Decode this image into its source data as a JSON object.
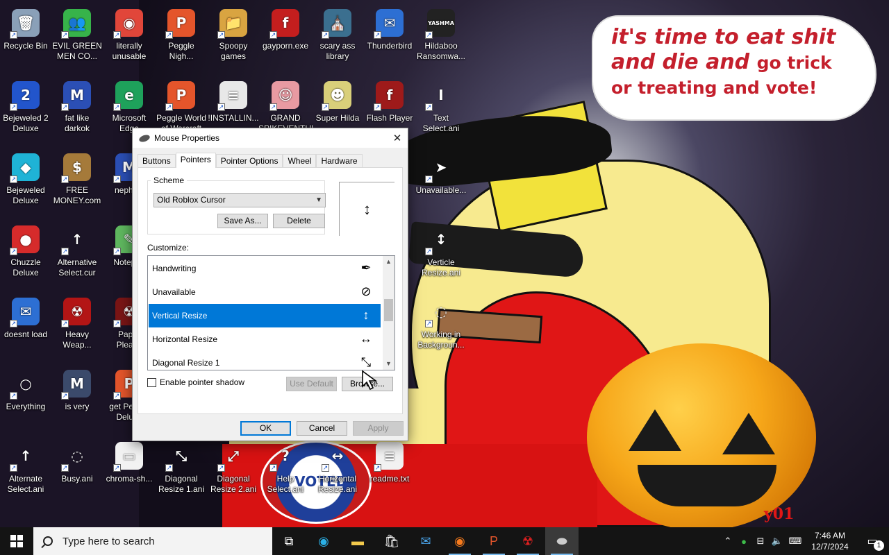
{
  "wallpaper": {
    "speech_line1": "it's time to eat shit",
    "speech_line2a": "and die and",
    "speech_line2b": "go trick",
    "speech_line3": "or treating and vote!",
    "voted_badge": "I VOTED",
    "corner_mark": "y01"
  },
  "desktop": {
    "icons": [
      {
        "label": "Recycle Bin",
        "color": "#8aa0b8",
        "glyph": "🗑"
      },
      {
        "label": "EVIL GREEN\nMEN CO...",
        "color": "#37b34a",
        "glyph": "👥"
      },
      {
        "label": "literally\nunusable",
        "color": "#e1463a",
        "glyph": "◉"
      },
      {
        "label": "Peggle\nNigh...",
        "color": "#e4552b",
        "glyph": "P"
      },
      {
        "label": "Spoopy\ngames",
        "color": "#d9a441",
        "glyph": "📁"
      },
      {
        "label": "gayporn.exe",
        "color": "#c41e1e",
        "glyph": "f"
      },
      {
        "label": "scary ass\nlibrary",
        "color": "#3b6f8f",
        "glyph": "⛪"
      },
      {
        "label": "Thunderbird",
        "color": "#2d6fd3",
        "glyph": "✉"
      },
      {
        "label": "Hildaboo\nRansomwa...",
        "color": "#222222",
        "glyph": "YASHMA"
      },
      {
        "label": "Bejeweled 2\nDeluxe",
        "color": "#2255cc",
        "glyph": "2"
      },
      {
        "label": "fat like\ndarkok",
        "color": "#2b4fb5",
        "glyph": "M"
      },
      {
        "label": "Microsoft\nEdge",
        "color": "#1ea15b",
        "glyph": "e"
      },
      {
        "label": "Peggle World\nof Warcraft",
        "color": "#e4552b",
        "glyph": "P"
      },
      {
        "label": "!INSTALLIN...",
        "color": "#e8e8e8",
        "glyph": "≡"
      },
      {
        "label": "GRAND\nSPIKEVENTURE",
        "color": "#e89aa2",
        "glyph": "☺"
      },
      {
        "label": "Super Hilda",
        "color": "#d9cf7a",
        "glyph": "☻"
      },
      {
        "label": "Flash Player",
        "color": "#9e1a1a",
        "glyph": "f"
      },
      {
        "label": "Text\nSelect.ani",
        "color": "transparent",
        "glyph": "I"
      },
      {
        "label": "Bejeweled\nDeluxe",
        "color": "#1fb3d6",
        "glyph": "◆"
      },
      {
        "label": "FREE\nMONEY.com",
        "color": "#a57a3a",
        "glyph": "$"
      },
      {
        "label": "nephew",
        "color": "#2b4fb5",
        "glyph": "M"
      },
      {
        "label": "Unavailable...",
        "color": "transparent",
        "glyph": "➤"
      },
      {
        "label": "Chuzzle\nDeluxe",
        "color": "#d62b2b",
        "glyph": "●"
      },
      {
        "label": "Alternative\nSelect.cur",
        "color": "transparent",
        "glyph": "↑"
      },
      {
        "label": "Notepad",
        "color": "#5fb85f",
        "glyph": "✎"
      },
      {
        "label": "Verticle\nResize.ani",
        "color": "transparent",
        "glyph": "↕"
      },
      {
        "label": "doesnt load",
        "color": "#2d6fd3",
        "glyph": "✉"
      },
      {
        "label": "Heavy\nWeap...",
        "color": "#b31515",
        "glyph": "☢"
      },
      {
        "label": "Paper\nPlease",
        "color": "#7a1515",
        "glyph": "☢"
      },
      {
        "label": "Working in\nBackgroun...",
        "color": "transparent",
        "glyph": "◌"
      },
      {
        "label": "Everything",
        "color": "transparent",
        "glyph": "○"
      },
      {
        "label": "is very",
        "color": "#3b4a6b",
        "glyph": "M"
      },
      {
        "label": "get Peggle\nDeluxe",
        "color": "#e4552b",
        "glyph": "P"
      },
      {
        "label": "Alternate\nSelect.ani",
        "color": "transparent",
        "glyph": "↑"
      },
      {
        "label": "Busy.ani",
        "color": "transparent",
        "glyph": "◌"
      },
      {
        "label": "chroma-sh...",
        "color": "#f2f2f2",
        "glyph": "▭"
      },
      {
        "label": "Diagonal\nResize 1.ani",
        "color": "transparent",
        "glyph": "⤡"
      },
      {
        "label": "Diagonal\nResize 2.ani",
        "color": "transparent",
        "glyph": "⤢"
      },
      {
        "label": "Help\nSelect.ani",
        "color": "transparent",
        "glyph": "?"
      },
      {
        "label": "Horizontal\nResize.ani",
        "color": "transparent",
        "glyph": "↔"
      },
      {
        "label": "readme.txt",
        "color": "#f2f2f2",
        "glyph": "≡"
      }
    ]
  },
  "dialog": {
    "title": "Mouse Properties",
    "close_glyph": "✕",
    "tabs": [
      "Buttons",
      "Pointers",
      "Pointer Options",
      "Wheel",
      "Hardware"
    ],
    "active_tab": "Pointers",
    "scheme_label": "Scheme",
    "scheme_value": "Old Roblox Cursor",
    "save_as_label": "Save As...",
    "delete_label": "Delete",
    "preview_glyph": "↕",
    "customize_label": "Customize:",
    "list_items": [
      {
        "label": "Handwriting",
        "cursor": "✒"
      },
      {
        "label": "Unavailable",
        "cursor": "⊘"
      },
      {
        "label": "Vertical Resize",
        "cursor": "↕",
        "selected": true
      },
      {
        "label": "Horizontal Resize",
        "cursor": "↔"
      },
      {
        "label": "Diagonal Resize 1",
        "cursor": "⤡"
      }
    ],
    "enable_shadow_label": "Enable pointer shadow",
    "use_default_label": "Use Default",
    "browse_label": "Browse...",
    "ok_label": "OK",
    "cancel_label": "Cancel",
    "apply_label": "Apply"
  },
  "taskbar": {
    "search_placeholder": "Type here to search",
    "time": "7:46 AM",
    "date": "12/7/2024",
    "notification_count": "1"
  }
}
